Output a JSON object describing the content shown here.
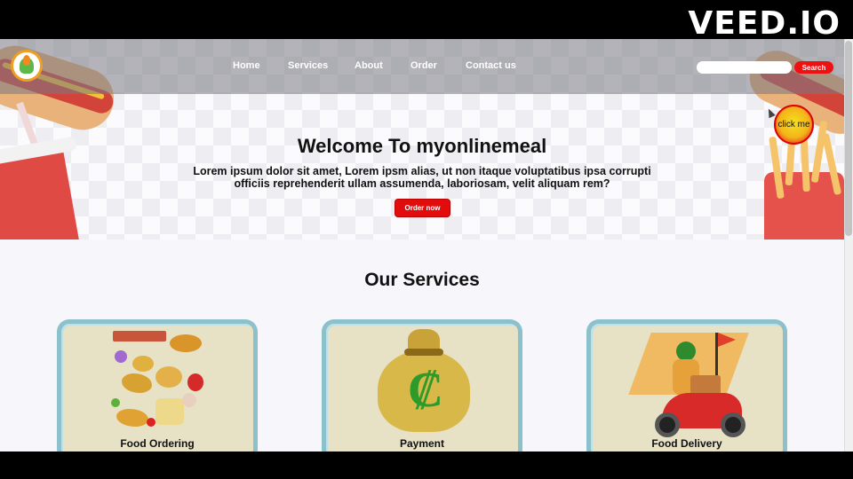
{
  "watermark": "VEED.IO",
  "nav": {
    "links": [
      "Home",
      "Services",
      "About",
      "Order",
      "Contact us"
    ],
    "search_placeholder": "",
    "search_button": "Search"
  },
  "hero": {
    "title": "Welcome To myonlinemeal",
    "text": "Lorem ipsum dolor sit amet, Lorem ipsm alias, ut non itaque voluptatibus ipsa corrupti officiis reprehenderit ullam assumenda, laboriosam, velit aliquam rem?",
    "cta": "Order now",
    "float_button": "click me"
  },
  "services": {
    "title": "Our Services",
    "cards": [
      {
        "title": "Food Ordering",
        "icon": "food-ordering-icon"
      },
      {
        "title": "Payment",
        "icon": "money-bag-icon"
      },
      {
        "title": "Food Delivery",
        "icon": "delivery-scooter-icon"
      }
    ]
  },
  "colors": {
    "accent": "#e30c0c",
    "card_bg": "#e7e1c6",
    "card_border": "#8cc1cc",
    "nav_overlay": "#787882"
  }
}
